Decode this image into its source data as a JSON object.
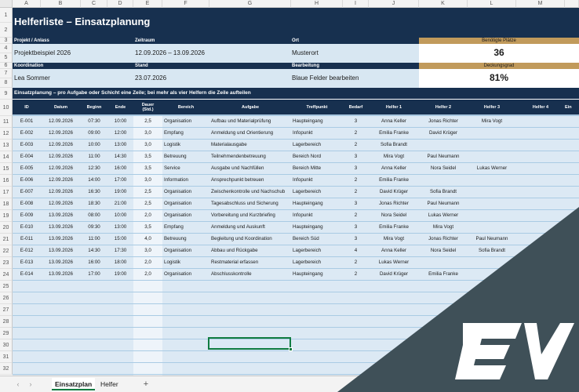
{
  "columns": [
    "A",
    "B",
    "C",
    "D",
    "E",
    "F",
    "G",
    "H",
    "I",
    "J",
    "K",
    "L",
    "M"
  ],
  "rows": [
    "1",
    "2",
    "3",
    "4",
    "5",
    "6",
    "7",
    "8",
    "9",
    "10",
    "11",
    "12",
    "13",
    "14",
    "15",
    "16",
    "17",
    "18",
    "19",
    "20",
    "21",
    "22",
    "23",
    "24",
    "25",
    "26",
    "27",
    "28",
    "29",
    "30",
    "31",
    "32"
  ],
  "title": "Helferliste – Einsatzplanung",
  "header": {
    "projekt_label": "Projekt / Anlass",
    "projekt_value": "Projektbeispiel 2026",
    "zeitraum_label": "Zeitraum",
    "zeitraum_value": "12.09.2026 – 13.09.2026",
    "ort_label": "Ort",
    "ort_value": "Musterort",
    "benoetigt_label": "Benötigte Plätze",
    "benoetigt_value": "36",
    "koordination_label": "Koordination",
    "koordination_value": "Lea Sommer",
    "stand_label": "Stand",
    "stand_value": "23.07.2026",
    "bearbeitung_label": "Bearbeitung",
    "bearbeitung_value": "Blaue Felder bearbeiten",
    "deckung_label": "Deckungsgrad",
    "deckung_value": "81%"
  },
  "section_title": "Einsatzplanung – pro Aufgabe oder Schicht eine Zeile; bei mehr als vier Helfern die Zeile aufteilen",
  "table_headers": {
    "id": "ID",
    "datum": "Datum",
    "beginn": "Beginn",
    "ende": "Ende",
    "dauer1": "Dauer",
    "dauer2": "(Std.)",
    "bereich": "Bereich",
    "aufgabe": "Aufgabe",
    "treffpunkt": "Treffpunkt",
    "bedarf": "Bedarf",
    "helfer1": "Helfer 1",
    "helfer2": "Helfer 2",
    "helfer3": "Helfer 3",
    "helfer4": "Helfer 4",
    "ein": "Ein"
  },
  "table_rows": [
    [
      "E-001",
      "12.09.2026",
      "07:30",
      "10:00",
      "2,5",
      "Organisation",
      "Aufbau und Materialprüfung",
      "Haupteingang",
      "3",
      "Anna Keller",
      "Jonas Richter",
      "Mira Vogt",
      ""
    ],
    [
      "E-002",
      "12.09.2026",
      "09:00",
      "12:00",
      "3,0",
      "Empfang",
      "Anmeldung und Orientierung",
      "Infopunkt",
      "2",
      "Emilia Franke",
      "David Krüger",
      "",
      ""
    ],
    [
      "E-003",
      "12.09.2026",
      "10:00",
      "13:00",
      "3,0",
      "Logistik",
      "Materialausgabe",
      "Lagerbereich",
      "2",
      "Sofia Brandt",
      "",
      "",
      ""
    ],
    [
      "E-004",
      "12.09.2026",
      "11:00",
      "14:30",
      "3,5",
      "Betreuung",
      "Teilnehmendenbetreuung",
      "Bereich Nord",
      "3",
      "Mira Vogt",
      "Paul Neumann",
      "",
      ""
    ],
    [
      "E-005",
      "12.09.2026",
      "12:30",
      "16:00",
      "3,5",
      "Service",
      "Ausgabe und Nachfüllen",
      "Bereich Mitte",
      "3",
      "Anna Keller",
      "Nora Seidel",
      "Lukas Werner",
      ""
    ],
    [
      "E-006",
      "12.09.2026",
      "14:00",
      "17:00",
      "3,0",
      "Information",
      "Ansprechpunkt betreuen",
      "Infopunkt",
      "2",
      "Emilia Franke",
      "",
      "",
      ""
    ],
    [
      "E-007",
      "12.09.2026",
      "16:30",
      "19:00",
      "2,5",
      "Organisation",
      "Zwischenkontrolle und Nachschub",
      "Lagerbereich",
      "2",
      "David Krüger",
      "Sofia Brandt",
      "",
      ""
    ],
    [
      "E-008",
      "12.09.2026",
      "18:30",
      "21:00",
      "2,5",
      "Organisation",
      "Tagesabschluss und Sicherung",
      "Haupteingang",
      "3",
      "Jonas Richter",
      "Paul Neumann",
      "",
      ""
    ],
    [
      "E-009",
      "13.09.2026",
      "08:00",
      "10:00",
      "2,0",
      "Organisation",
      "Vorbereitung und Kurzbriefing",
      "Infopunkt",
      "2",
      "Nora Seidel",
      "Lukas Werner",
      "",
      ""
    ],
    [
      "E-010",
      "13.09.2026",
      "09:30",
      "13:00",
      "3,5",
      "Empfang",
      "Anmeldung und Auskunft",
      "Haupteingang",
      "3",
      "Emilia Franke",
      "Mira Vogt",
      "",
      ""
    ],
    [
      "E-011",
      "13.09.2026",
      "11:00",
      "15:00",
      "4,0",
      "Betreuung",
      "Begleitung und Koordination",
      "Bereich Süd",
      "3",
      "Mira Vogt",
      "Jonas Richter",
      "Paul Neumann",
      ""
    ],
    [
      "E-012",
      "13.09.2026",
      "14:30",
      "17:30",
      "3,0",
      "Organisation",
      "Abbau und Rückgabe",
      "Lagerbereich",
      "4",
      "Anna Keller",
      "Nora Seidel",
      "Sofia Brandt",
      ""
    ],
    [
      "E-013",
      "13.09.2026",
      "16:00",
      "18:00",
      "2,0",
      "Logistik",
      "Restmaterial erfassen",
      "Lagerbereich",
      "2",
      "Lukas Werner",
      "",
      "",
      ""
    ],
    [
      "E-014",
      "13.09.2026",
      "17:00",
      "19:00",
      "2,0",
      "Organisation",
      "Abschlusskontrolle",
      "Haupteingang",
      "2",
      "David Krüger",
      "Emilia Franke",
      "",
      ""
    ]
  ],
  "sheet_tabs": [
    "Einsatzplan",
    "Helfer"
  ],
  "logo_text": "EV",
  "colors": {
    "navy": "#17304f",
    "light_blue": "#d8e7f2",
    "gold": "#c19a5b",
    "tab_green": "#107c41",
    "logo_bg": "#3f5058"
  }
}
